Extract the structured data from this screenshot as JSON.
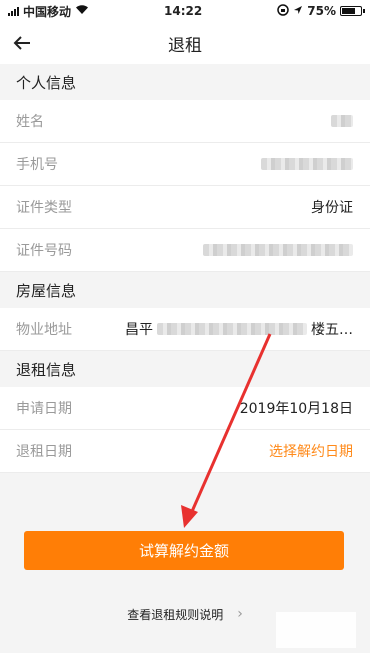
{
  "status": {
    "carrier": "中国移动",
    "time": "14:22",
    "battery": "75%"
  },
  "nav": {
    "title": "退租"
  },
  "sections": {
    "personal": "个人信息",
    "house": "房屋信息",
    "lease": "退租信息"
  },
  "fields": {
    "name_label": "姓名",
    "phone_label": "手机号",
    "id_type_label": "证件类型",
    "id_type_value": "身份证",
    "id_number_label": "证件号码",
    "address_label": "物业地址",
    "address_prefix": "昌平",
    "address_suffix": "楼五…",
    "apply_date_label": "申请日期",
    "apply_date_value": "2019年10月18日",
    "end_date_label": "退租日期",
    "end_date_value": "选择解约日期"
  },
  "actions": {
    "calc_button": "试算解约金额",
    "rules_link": "查看退租规则说明"
  },
  "colors": {
    "accent": "#ff7e06",
    "arrow": "#e8312f"
  }
}
